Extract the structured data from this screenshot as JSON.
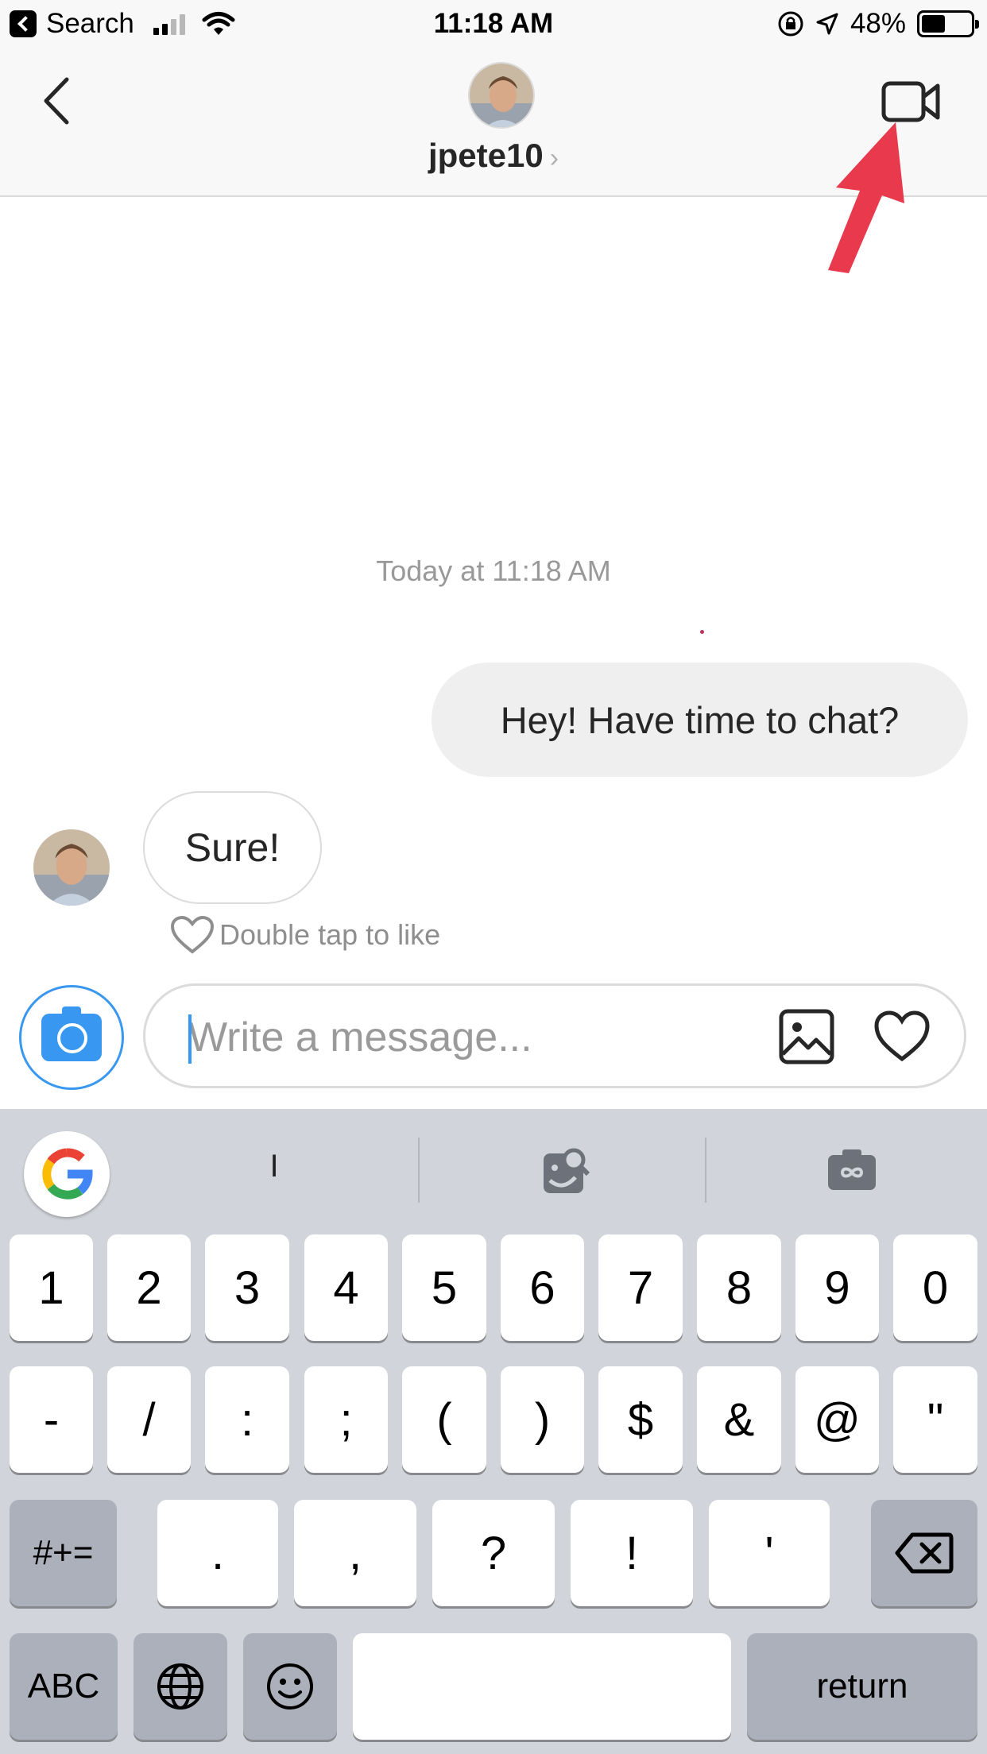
{
  "status_bar": {
    "back_app": "Search",
    "time": "11:18 AM",
    "battery": "48%",
    "battery_level": 0.48,
    "signal_bars": 2
  },
  "header": {
    "username": "jpete10",
    "chevron": "›"
  },
  "chat": {
    "timestamp": "Today at 11:18 AM",
    "messages": [
      {
        "from": "me",
        "text": "Hey! Have time to chat?"
      },
      {
        "from": "them",
        "text": "Sure!"
      }
    ],
    "like_hint": "Double tap to like"
  },
  "composer": {
    "placeholder": "Write a message...",
    "value": ""
  },
  "keyboard": {
    "suggestion": "I",
    "row1": [
      "1",
      "2",
      "3",
      "4",
      "5",
      "6",
      "7",
      "8",
      "9",
      "0"
    ],
    "row2": [
      "-",
      "/",
      ":",
      ";",
      "(",
      ")",
      "$",
      "&",
      "@",
      "\""
    ],
    "row3": {
      "shift": "#+=",
      "keys": [
        ".",
        ",",
        "?",
        "!",
        "'"
      ]
    },
    "row4": {
      "abc": "ABC",
      "return": "return"
    }
  },
  "colors": {
    "accent": "#3897f0",
    "annotation_arrow": "#e8394d",
    "keyboard_bg": "#d1d4da"
  },
  "icons": [
    "back-arrow-icon",
    "video-camera-icon",
    "camera-icon",
    "image-icon",
    "heart-icon",
    "google-icon",
    "image-search-icon",
    "gif-camera-icon",
    "delete-icon",
    "globe-icon",
    "emoji-icon",
    "wifi-icon",
    "location-icon",
    "orientation-lock-icon"
  ]
}
